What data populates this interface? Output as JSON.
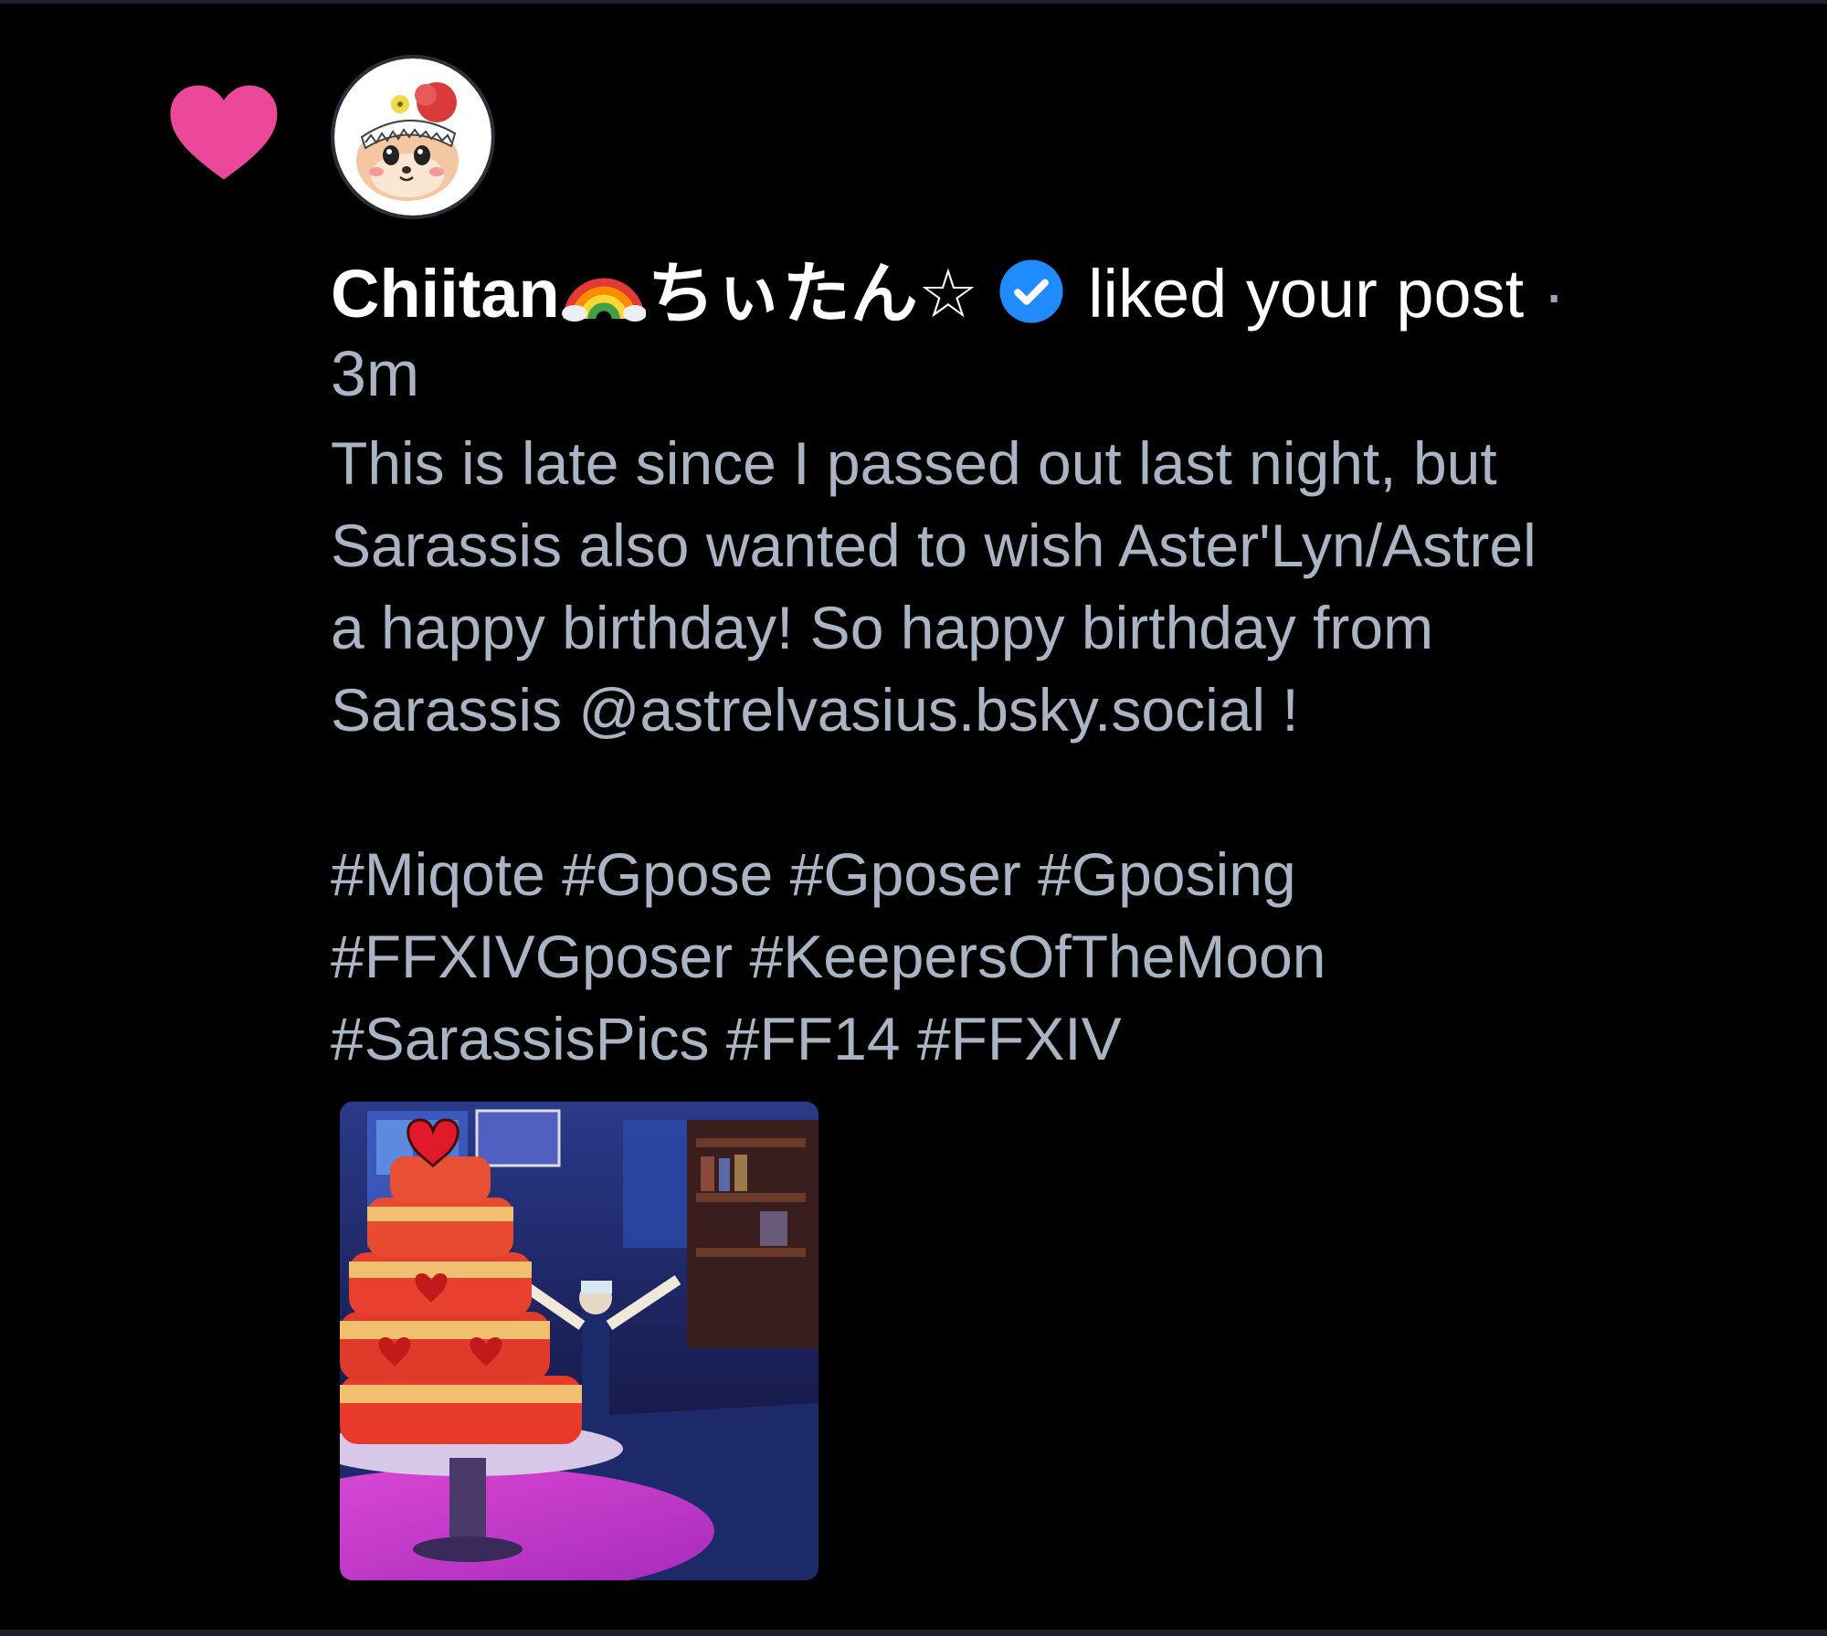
{
  "notification": {
    "type_icon": "heart-icon",
    "avatar_icon": "avatar",
    "author": {
      "name": "Chiitan",
      "name_jp": "ちぃたん☆",
      "emoji": "rainbow-icon",
      "verified_icon": "verified-checkmark-icon"
    },
    "action": "liked your post",
    "separator": "·",
    "time": "3m",
    "post": {
      "body_lines": [
        "This is late since I passed out last night, but",
        "Sarassis also wanted to wish Aster'Lyn/Astrel",
        "a happy birthday! So happy birthday from",
        "Sarassis @astrelvasius.bsky.social !"
      ],
      "hashtag_lines": [
        "#Miqote #Gpose #Gposer #Gposing",
        "#FFXIVGposer #KeepersOfTheMoon",
        "#SarassisPics #FF14 #FFXIV"
      ],
      "image": "post-image-thumbnail"
    }
  },
  "colors": {
    "background": "#000000",
    "heart": "#ec4899",
    "verified": "#208bfe",
    "text_primary": "#ffffff",
    "text_secondary": "#aab4c4"
  }
}
